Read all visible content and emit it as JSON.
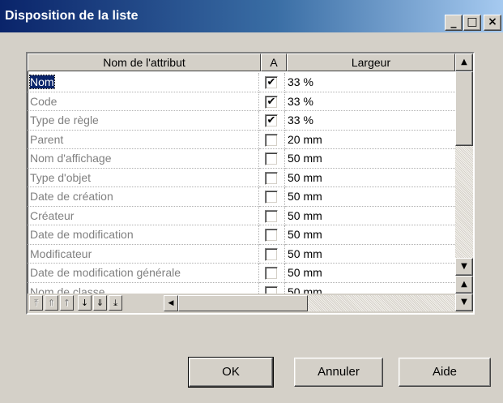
{
  "window": {
    "title": "Disposition de la liste",
    "controls": {
      "minimize": "_",
      "maximize": "□",
      "close": "×"
    }
  },
  "grid": {
    "columns": [
      "Nom de l'attribut",
      "A",
      "Largeur"
    ],
    "rows": [
      {
        "name": "Nom",
        "checked": "✔",
        "width": "33 %",
        "selected": true
      },
      {
        "name": "Code",
        "checked": "✔",
        "width": "33 %"
      },
      {
        "name": "Type de règle",
        "checked": "✔",
        "width": "33 %"
      },
      {
        "name": "Parent",
        "checked": "",
        "width": "20 mm"
      },
      {
        "name": "Nom d'affichage",
        "checked": "",
        "width": "50 mm"
      },
      {
        "name": "Type d'objet",
        "checked": "",
        "width": "50 mm"
      },
      {
        "name": "Date de création",
        "checked": "",
        "width": "50 mm"
      },
      {
        "name": "Créateur",
        "checked": "",
        "width": "50 mm"
      },
      {
        "name": "Date de modification",
        "checked": "",
        "width": "50 mm"
      },
      {
        "name": "Modificateur",
        "checked": "",
        "width": "50 mm"
      },
      {
        "name": "Date de modification générale",
        "checked": "",
        "width": "50 mm"
      },
      {
        "name": "Nom de classe",
        "checked": "",
        "width": "50 mm"
      }
    ]
  },
  "move_buttons": {
    "top": "⤒",
    "up_page": "⇑",
    "up": "↑",
    "down": "↓",
    "down_page": "⇓",
    "bottom": "⤓"
  },
  "scroll_glyphs": {
    "up": "▲",
    "down": "▼",
    "left": "◀",
    "right": "▶",
    "page_up": "▲",
    "page_down": "▼"
  },
  "buttons": {
    "ok": "OK",
    "cancel": "Annuler",
    "help": "Aide"
  }
}
